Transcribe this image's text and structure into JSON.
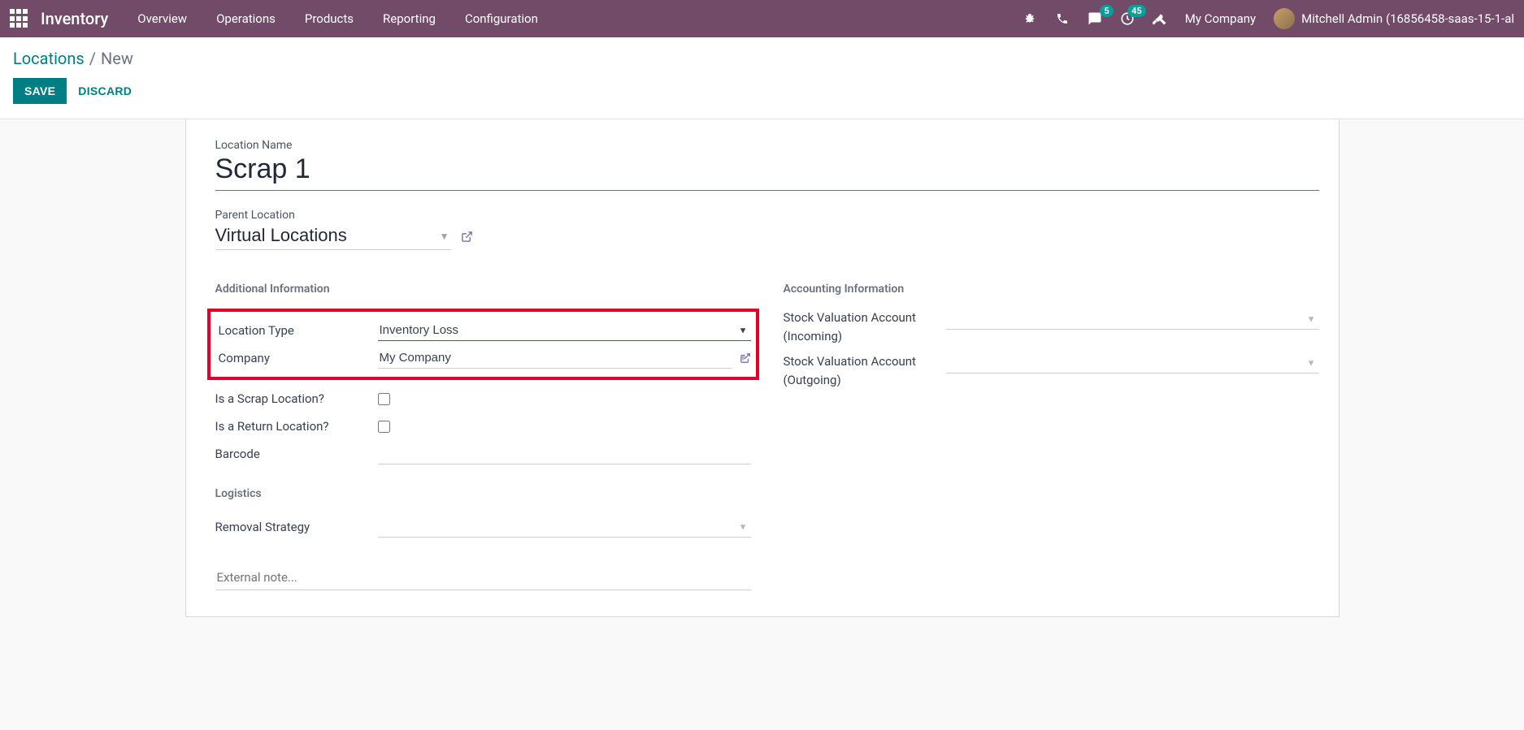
{
  "topbar": {
    "app_title": "Inventory",
    "menu": [
      "Overview",
      "Operations",
      "Products",
      "Reporting",
      "Configuration"
    ],
    "msg_badge": "5",
    "activity_badge": "45",
    "company": "My Company",
    "user": "Mitchell Admin (16856458-saas-15-1-al"
  },
  "breadcrumb": {
    "parent": "Locations",
    "current": "New"
  },
  "actions": {
    "save": "SAVE",
    "discard": "DISCARD"
  },
  "form": {
    "location_name_label": "Location Name",
    "location_name_value": "Scrap 1",
    "parent_location_label": "Parent Location",
    "parent_location_value": "Virtual Locations",
    "sections": {
      "additional": {
        "title": "Additional Information",
        "location_type_label": "Location Type",
        "location_type_value": "Inventory Loss",
        "company_label": "Company",
        "company_value": "My Company",
        "is_scrap_label": "Is a Scrap Location?",
        "is_return_label": "Is a Return Location?",
        "barcode_label": "Barcode",
        "barcode_value": ""
      },
      "accounting": {
        "title": "Accounting Information",
        "sva_in_label": "Stock Valuation Account (Incoming)",
        "sva_in_value": "",
        "sva_out_label": "Stock Valuation Account (Outgoing)",
        "sva_out_value": ""
      },
      "logistics": {
        "title": "Logistics",
        "removal_label": "Removal Strategy",
        "removal_value": ""
      }
    },
    "note_placeholder": "External note..."
  }
}
